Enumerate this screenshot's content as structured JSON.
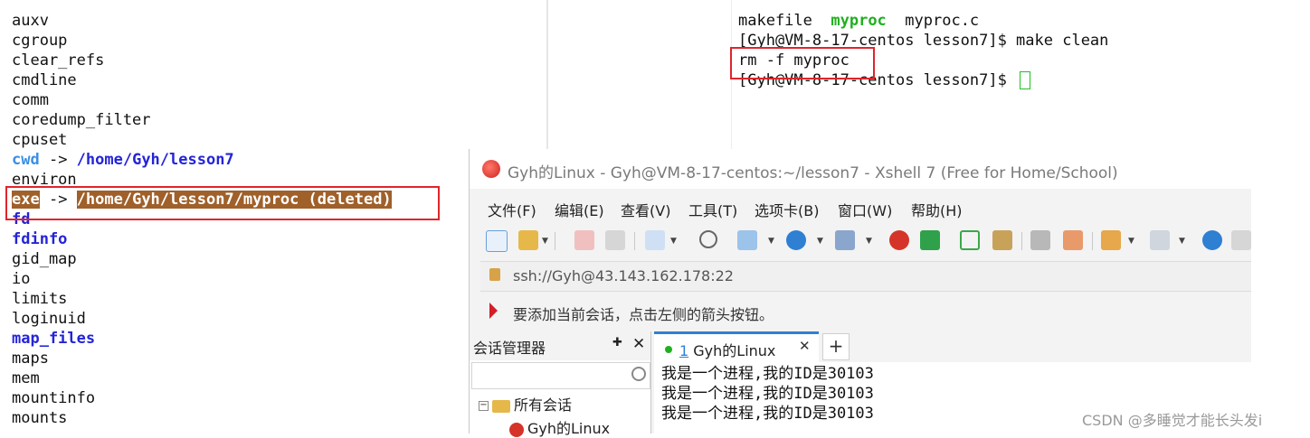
{
  "left_terminal": {
    "lines": [
      "auxv",
      "cgroup",
      "clear_refs",
      "cmdline",
      "comm",
      "coredump_filter",
      "cpuset"
    ],
    "cwd_name": "cwd",
    "arrow": " -> ",
    "cwd_target": "/home/Gyh/lesson7",
    "environ": "environ",
    "exe_name": "exe",
    "exe_target": "/home/Gyh/lesson7/myproc (deleted)",
    "lines2": [
      "fd",
      "fdinfo",
      "gid_map",
      "io",
      "limits",
      "loginuid",
      "map_files",
      "maps",
      "mem",
      "mountinfo",
      "mounts"
    ]
  },
  "right_terminal": {
    "file_makefile": "makefile",
    "file_myproc": "myproc",
    "file_myproc_c": "myproc.c",
    "prompt1": "[Gyh@VM-8-17-centos lesson7]$ make clean",
    "rm_cmd": "rm -f myproc",
    "prompt2": "[Gyh@VM-8-17-centos lesson7]$ "
  },
  "xshell": {
    "title": "Gyh的Linux - Gyh@VM-8-17-centos:~/lesson7 - Xshell 7 (Free for Home/School)",
    "menu": [
      "文件(F)",
      "编辑(E)",
      "查看(V)",
      "工具(T)",
      "选项卡(B)",
      "窗口(W)",
      "帮助(H)"
    ],
    "address": "ssh://Gyh@43.143.162.178:22",
    "hint": "要添加当前会话，点击左侧的箭头按钮。",
    "session_manager": "会话管理器",
    "pin": "✚",
    "close": "✕",
    "tree_root": "所有会话",
    "tree_child": "Gyh的Linux",
    "tab_number": "1",
    "tab_label": " Gyh的Linux",
    "tab_close": "✕",
    "tab_add": "+",
    "output": [
      "我是一个进程,我的ID是30103",
      "我是一个进程,我的ID是30103",
      "我是一个进程,我的ID是30103"
    ]
  },
  "watermark": "CSDN @多睡觉才能长头发i"
}
